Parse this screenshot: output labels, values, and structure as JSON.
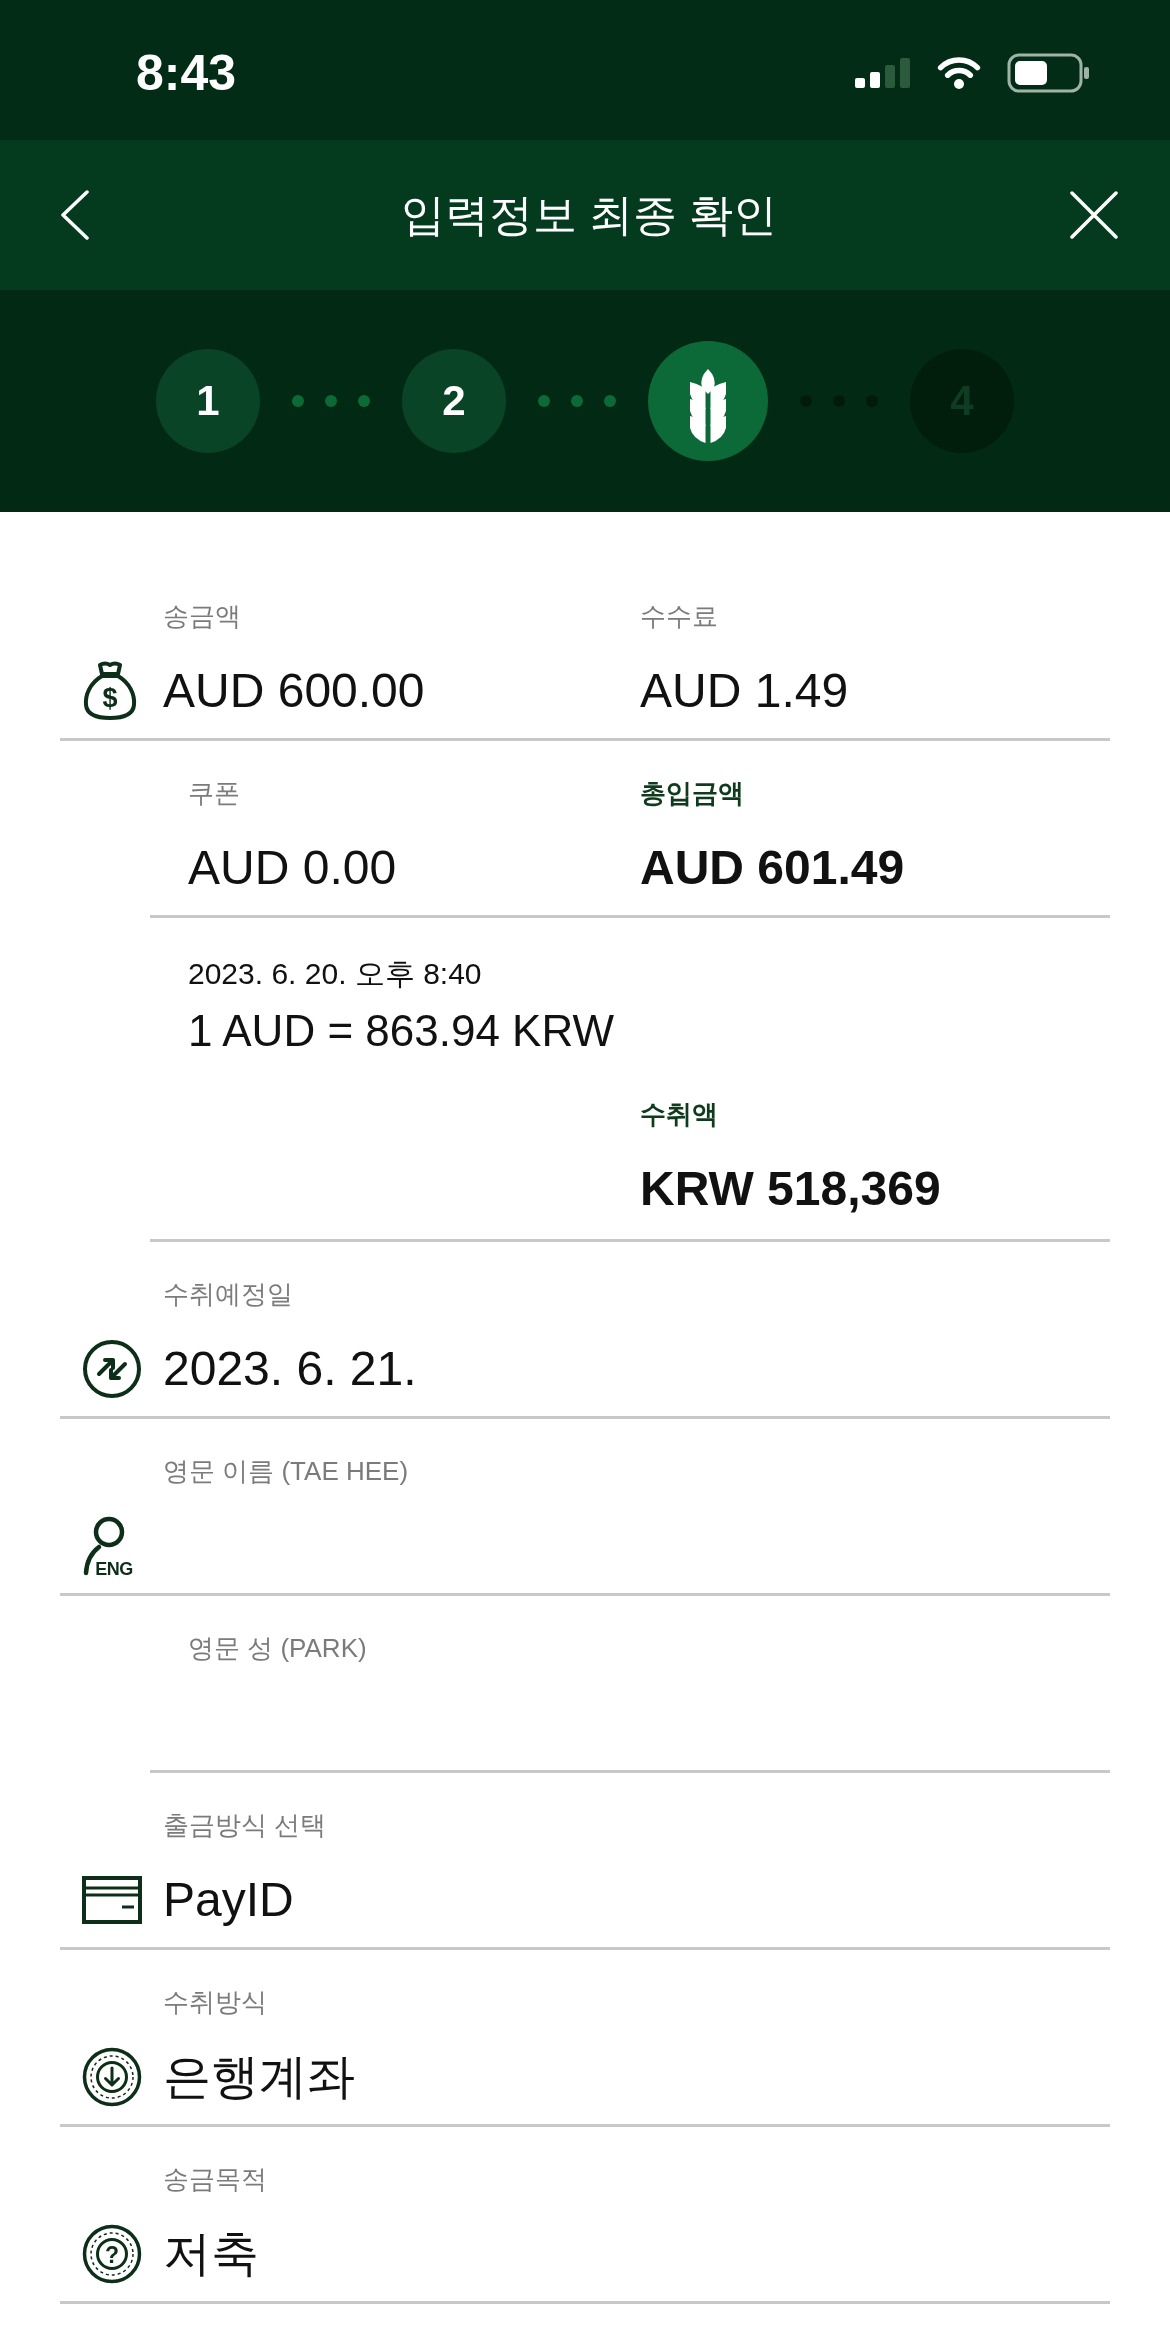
{
  "status_bar": {
    "time": "8:43"
  },
  "nav": {
    "title": "입력정보 최종 확인"
  },
  "stepper": {
    "steps": [
      {
        "label": "1",
        "completed": true,
        "selected": false
      },
      {
        "label": "2",
        "completed": true,
        "selected": false
      },
      {
        "completed": false,
        "selected": true
      },
      {
        "label": "4",
        "completed": false,
        "selected": false
      }
    ]
  },
  "rows": [
    {
      "kind": "amount",
      "icon_glyph": "$",
      "fields": [
        {
          "label": "송금액",
          "value": "AUD 600.00",
          "emphasis": false
        },
        {
          "label": "수수료",
          "value": "AUD 1.49",
          "emphasis": false
        }
      ]
    },
    {
      "kind": "detail",
      "fields": [
        {
          "label": "쿠폰",
          "value": "AUD 0.00",
          "emphasis": false
        },
        {
          "label": "총입금액",
          "value": "AUD 601.49",
          "emphasis": true
        }
      ]
    },
    {
      "kind": "rate",
      "timestamp": "2023. 6. 20. 오후 8:40",
      "rate": "1 AUD = 863.94 KRW",
      "fields": [
        {
          "label": "수취액",
          "value": "KRW 518,369",
          "emphasis": true
        }
      ]
    },
    {
      "kind": "schedule",
      "fields": [
        {
          "label": "수취예정일",
          "value": "2023. 6. 21.",
          "emphasis": false
        }
      ]
    },
    {
      "kind": "name",
      "icon_glyph": "ENG",
      "fields": [
        {
          "label": "영문 이름 (TAE HEE)",
          "emphasis": false
        }
      ]
    },
    {
      "kind": "detail",
      "fields": [
        {
          "label": "영문 성 (PARK)",
          "emphasis": false
        }
      ]
    },
    {
      "kind": "card",
      "fields": [
        {
          "label": "출금방식 선택",
          "value": "PayID",
          "emphasis": false
        }
      ]
    },
    {
      "kind": "receive",
      "fields": [
        {
          "label": "수취방식",
          "value": "은행계좌",
          "emphasis": false
        }
      ]
    },
    {
      "kind": "purpose",
      "icon_glyph": "?",
      "fields": [
        {
          "label": "송금목적",
          "value": "저축",
          "emphasis": false
        }
      ]
    }
  ]
}
